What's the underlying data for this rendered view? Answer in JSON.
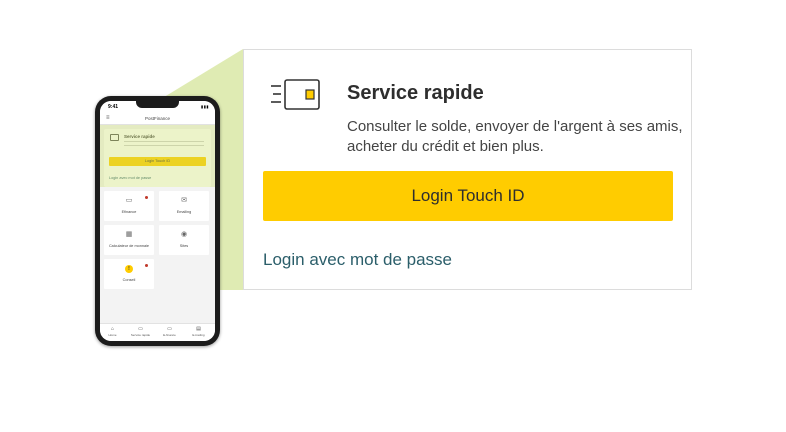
{
  "phone": {
    "status_time": "9:41",
    "app_title": "PostFinance",
    "card": {
      "title": "Service rapide",
      "touch_button": "Login Touch ID",
      "password_link": "Login avec mot de passe"
    },
    "tiles": [
      {
        "label": "Efinance",
        "icon": "laptop-icon"
      },
      {
        "label": "Emailing",
        "icon": "mail-icon"
      },
      {
        "label": "Calculateur de monnaie",
        "icon": "calculator-icon"
      },
      {
        "label": "Sites",
        "icon": "location-pin-icon"
      },
      {
        "label": "Conseil",
        "icon": "info-coin-icon"
      }
    ],
    "tabs": [
      {
        "label": "Home",
        "icon": "home-icon"
      },
      {
        "label": "Service rapide",
        "icon": "card-icon"
      },
      {
        "label": "E-finance",
        "icon": "laptop-icon"
      },
      {
        "label": "E-trading",
        "icon": "chart-icon"
      }
    ]
  },
  "callout": {
    "title": "Service rapide",
    "description": "Consulter le solde, envoyer de l'argent à ses amis, acheter du crédit et bien plus.",
    "touch_button": "Login Touch ID",
    "password_link": "Login avec mot de passe",
    "icon": "fast-card-icon"
  },
  "colors": {
    "accent_yellow": "#ffcc00",
    "link_teal": "#2b5e6a",
    "wedge_green": "#d9e8a6"
  }
}
